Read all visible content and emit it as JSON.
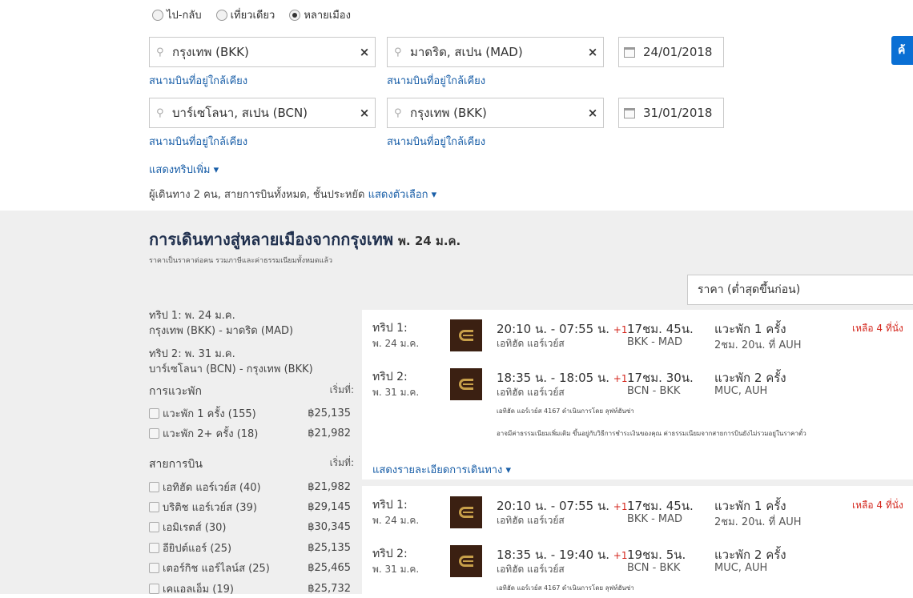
{
  "trip_type": {
    "options": [
      {
        "label": "ไป-กลับ",
        "selected": false
      },
      {
        "label": "เที่ยวเดียว",
        "selected": false
      },
      {
        "label": "หลายเมือง",
        "selected": true
      }
    ]
  },
  "legs_search": [
    {
      "from": "กรุงเทพ (BKK)",
      "to": "มาดริด, สเปน (MAD)",
      "date": "24/01/2018",
      "nearby": "สนามบินที่อยู่ใกล้เคียง"
    },
    {
      "from": "บาร์เซโลนา, สเปน (BCN)",
      "to": "กรุงเทพ (BKK)",
      "date": "31/01/2018",
      "nearby": "สนามบินที่อยู่ใกล้เคียง"
    }
  ],
  "search_button": "ค้",
  "show_more_trips": "แสดงทริปเพิ่ม ▾",
  "passengers": "ผู้เดินทาง 2 คน, สายการบินทั้งหมด, ชั้นประหยัด",
  "show_options": "แสดงตัวเลือก ▾",
  "results": {
    "title": "การเดินทางสู่หลายเมืองจากกรุงเทพ",
    "title_date": "พ. 24 ม.ค.",
    "price_note": "ราคาเป็นราคาต่อคน รวมภาษีและค่าธรรมเนียมทั้งหมดแล้ว",
    "sort": "ราคา (ต่ำสุดขึ้นก่อน)"
  },
  "sidebar": {
    "trip1_label": "ทริป 1: พ. 24 ม.ค.",
    "trip1_route": "กรุงเทพ (BKK) - มาดริด (MAD)",
    "trip2_label": "ทริป 2: พ. 31 ม.ค.",
    "trip2_route": "บาร์เซโลนา (BCN) - กรุงเทพ (BKK)",
    "stops_heading": "การแวะพัก",
    "airlines_heading": "สายการบิน",
    "from_label": "เริ่มที่:",
    "stops": [
      {
        "label": "แวะพัก 1 ครั้ง (155)",
        "price": "฿25,135"
      },
      {
        "label": "แวะพัก 2+ ครั้ง (18)",
        "price": "฿21,982"
      }
    ],
    "airlines": [
      {
        "label": "เอทิฮัด แอร์เวย์ส (40)",
        "price": "฿21,982"
      },
      {
        "label": "บริติช แอร์เวย์ส (39)",
        "price": "฿29,145"
      },
      {
        "label": "เอมิเรตส์ (30)",
        "price": "฿30,345"
      },
      {
        "label": "อียิปต์แอร์ (25)",
        "price": "฿25,135"
      },
      {
        "label": "เตอร์กิช แอร์ไลน์ส (25)",
        "price": "฿25,465"
      },
      {
        "label": "เคแอลเอ็ม (19)",
        "price": "฿25,732"
      }
    ]
  },
  "cards": [
    {
      "legs": [
        {
          "trip": "ทริป 1:",
          "date": "พ. 24 ม.ค.",
          "times": "20:10 น. - 07:55 น.",
          "plus": "+1",
          "airline": "เอทิฮัด แอร์เวย์ส",
          "duration": "17ชม. 45น.",
          "route": "BKK - MAD",
          "stops": "แวะพัก 1 ครั้ง",
          "via": "2ชม. 20น. ที่ AUH"
        },
        {
          "trip": "ทริป 2:",
          "date": "พ. 31 ม.ค.",
          "times": "18:35 น. - 18:05 น.",
          "plus": "+1",
          "airline": "เอทิฮัด แอร์เวย์ส",
          "duration": "17ชม. 30น.",
          "route": "BCN - BKK",
          "stops": "แวะพัก 2 ครั้ง",
          "via": "MUC, AUH"
        }
      ],
      "seats_left": "เหลือ 4 ที่นั่ง",
      "operated": "เอทิฮัด แอร์เวย์ส 4167 ดำเนินการโดย ลุฟท์ฮันซ่า",
      "fee_note": "อาจมีค่าธรรมเนียมเพิ่มเติม ขึ้นอยู่กับวิธีการชำระเงินของคุณ ค่าธรรมเนียมจากสายการบินยังไม่รวมอยู่ในราคาตั๋ว",
      "details": "แสดงรายละเอียดการเดินทาง ▾"
    },
    {
      "legs": [
        {
          "trip": "ทริป 1:",
          "date": "พ. 24 ม.ค.",
          "times": "20:10 น. - 07:55 น.",
          "plus": "+1",
          "airline": "เอทิฮัด แอร์เวย์ส",
          "duration": "17ชม. 45น.",
          "route": "BKK - MAD",
          "stops": "แวะพัก 1 ครั้ง",
          "via": "2ชม. 20น. ที่ AUH"
        },
        {
          "trip": "ทริป 2:",
          "date": "พ. 31 ม.ค.",
          "times": "18:35 น. - 19:40 น.",
          "plus": "+1",
          "airline": "เอทิฮัด แอร์เวย์ส",
          "duration": "19ชม. 5น.",
          "route": "BCN - BKK",
          "stops": "แวะพัก 2 ครั้ง",
          "via": "MUC, AUH"
        }
      ],
      "seats_left": "เหลือ 4 ที่นั่ง",
      "operated": "เอทิฮัด แอร์เวย์ส 4167 ดำเนินการโดย ลุฟท์ฮันซ่า"
    }
  ]
}
